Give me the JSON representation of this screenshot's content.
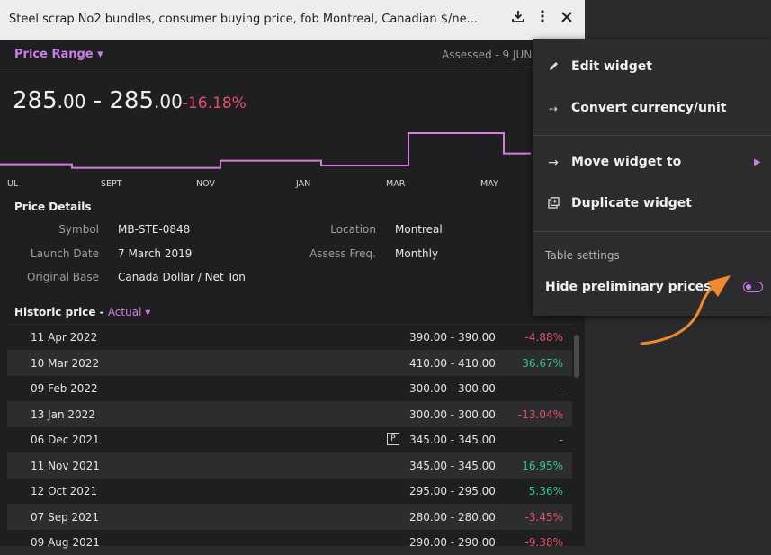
{
  "widget": {
    "title": "Steel scrap No2 bundles, consumer buying price, fob Montreal, Canadian $/ne...",
    "price_range_label": "Price Range",
    "assessed": "Assessed - 9 JUN",
    "price_low_int": "285",
    "price_low_dec": ".00",
    "price_sep": " - ",
    "price_high_int": "285",
    "price_high_dec": ".00",
    "price_change": "-16.18%"
  },
  "chart_data": {
    "type": "line",
    "x_ticks": [
      "UL",
      "SEPT",
      "NOV",
      "JAN",
      "MAR",
      "MAY"
    ],
    "series": [
      {
        "values": [
          285,
          270,
          270,
          300,
          300,
          280,
          280,
          415,
          415,
          330,
          330
        ]
      }
    ],
    "ylim": [
      250,
      430
    ],
    "color": "#d67ce0"
  },
  "details": {
    "title": "Price Details",
    "symbol_label": "Symbol",
    "symbol": "MB-STE-0848",
    "location_label": "Location",
    "location": "Montreal",
    "launch_label": "Launch Date",
    "launch": "7 March 2019",
    "freq_label": "Assess Freq.",
    "freq": "Monthly",
    "base_label": "Original Base",
    "base": "Canada Dollar / Net Ton"
  },
  "history": {
    "title": "Historic price - ",
    "mode": "Actual",
    "rows": [
      {
        "date": "11 Apr 2022",
        "price": "390.00 - 390.00",
        "pct": "-4.88%",
        "dir": "neg",
        "prelim": false
      },
      {
        "date": "10 Mar 2022",
        "price": "410.00 - 410.00",
        "pct": "36.67%",
        "dir": "pos",
        "prelim": false
      },
      {
        "date": "09 Feb 2022",
        "price": "300.00 - 300.00",
        "pct": "-",
        "dir": "nil",
        "prelim": false
      },
      {
        "date": "13 Jan 2022",
        "price": "300.00 - 300.00",
        "pct": "-13.04%",
        "dir": "neg",
        "prelim": false
      },
      {
        "date": "06 Dec 2021",
        "price": "345.00 - 345.00",
        "pct": "-",
        "dir": "nil",
        "prelim": true
      },
      {
        "date": "11 Nov 2021",
        "price": "345.00 - 345.00",
        "pct": "16.95%",
        "dir": "pos",
        "prelim": false
      },
      {
        "date": "12 Oct 2021",
        "price": "295.00 - 295.00",
        "pct": "5.36%",
        "dir": "pos",
        "prelim": false
      },
      {
        "date": "07 Sep 2021",
        "price": "280.00 - 280.00",
        "pct": "-3.45%",
        "dir": "neg",
        "prelim": false
      },
      {
        "date": "09 Aug 2021",
        "price": "290.00 - 290.00",
        "pct": "-9.38%",
        "dir": "neg",
        "prelim": false
      }
    ],
    "prelim_badge": "P"
  },
  "menu": {
    "edit": "Edit widget",
    "convert": "Convert currency/unit",
    "move": "Move widget to",
    "duplicate": "Duplicate widget",
    "table_settings": "Table settings",
    "hide_prelim": "Hide preliminary prices",
    "hide_prelim_on": false
  },
  "icons": {
    "download": "download-icon",
    "more": "more-vertical-icon",
    "close": "close-icon",
    "edit": "pencil-icon",
    "convert": "convert-icon",
    "move": "arrow-right-icon",
    "duplicate": "duplicate-icon",
    "submenu": "caret-right-icon"
  },
  "colors": {
    "accent": "#c97fe5",
    "negative": "#e0506a",
    "positive": "#34c48a",
    "annotation": "#f08a2e"
  }
}
